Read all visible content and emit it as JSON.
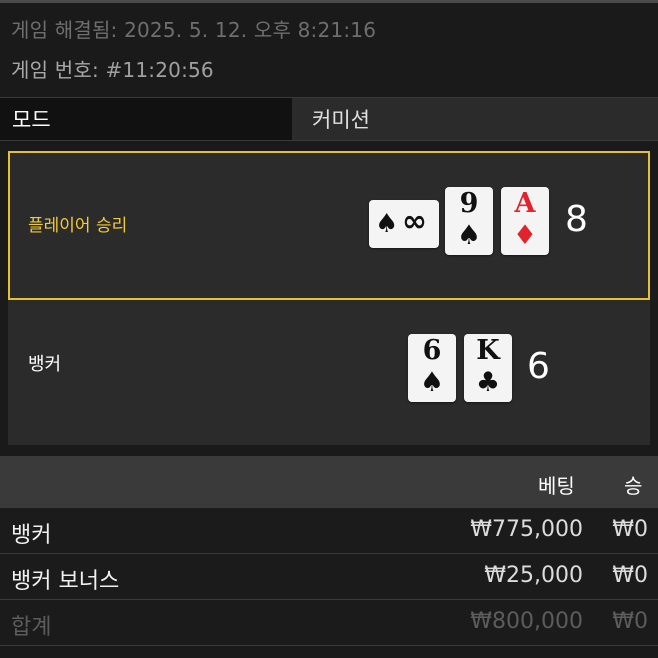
{
  "info": {
    "resolved_label": "게임 해결됨:",
    "resolved_value": "2025. 5. 12. 오후 8:21:16",
    "game_no_label": "게임 번호:",
    "game_no_value": "#11:20:56"
  },
  "tabs": {
    "mode": "모드",
    "commission": "커미션"
  },
  "player": {
    "name": "플레이어 승리",
    "cards": [
      {
        "type": "back",
        "suit": "♠",
        "mark": "∞",
        "icon": "spade-infinity-card"
      },
      {
        "rank": "9",
        "suit": "♠",
        "color": "black"
      },
      {
        "rank": "A",
        "suit": "♦",
        "color": "red"
      }
    ],
    "score": "8"
  },
  "banker": {
    "name": "뱅커",
    "cards": [
      {
        "rank": "6",
        "suit": "♠",
        "color": "black"
      },
      {
        "rank": "K",
        "suit": "♣",
        "color": "black"
      }
    ],
    "score": "6"
  },
  "table": {
    "headers": {
      "bet": "베팅",
      "win": "승"
    },
    "rows": [
      {
        "name": "뱅커",
        "bet": "₩775,000",
        "win": "₩0"
      },
      {
        "name": "뱅커 보너스",
        "bet": "₩25,000",
        "win": "₩0"
      },
      {
        "name": "합계",
        "bet": "₩800,000",
        "win": "₩0"
      }
    ]
  },
  "colors": {
    "highlight": "#e6c230",
    "red_suit": "#e0242c"
  }
}
